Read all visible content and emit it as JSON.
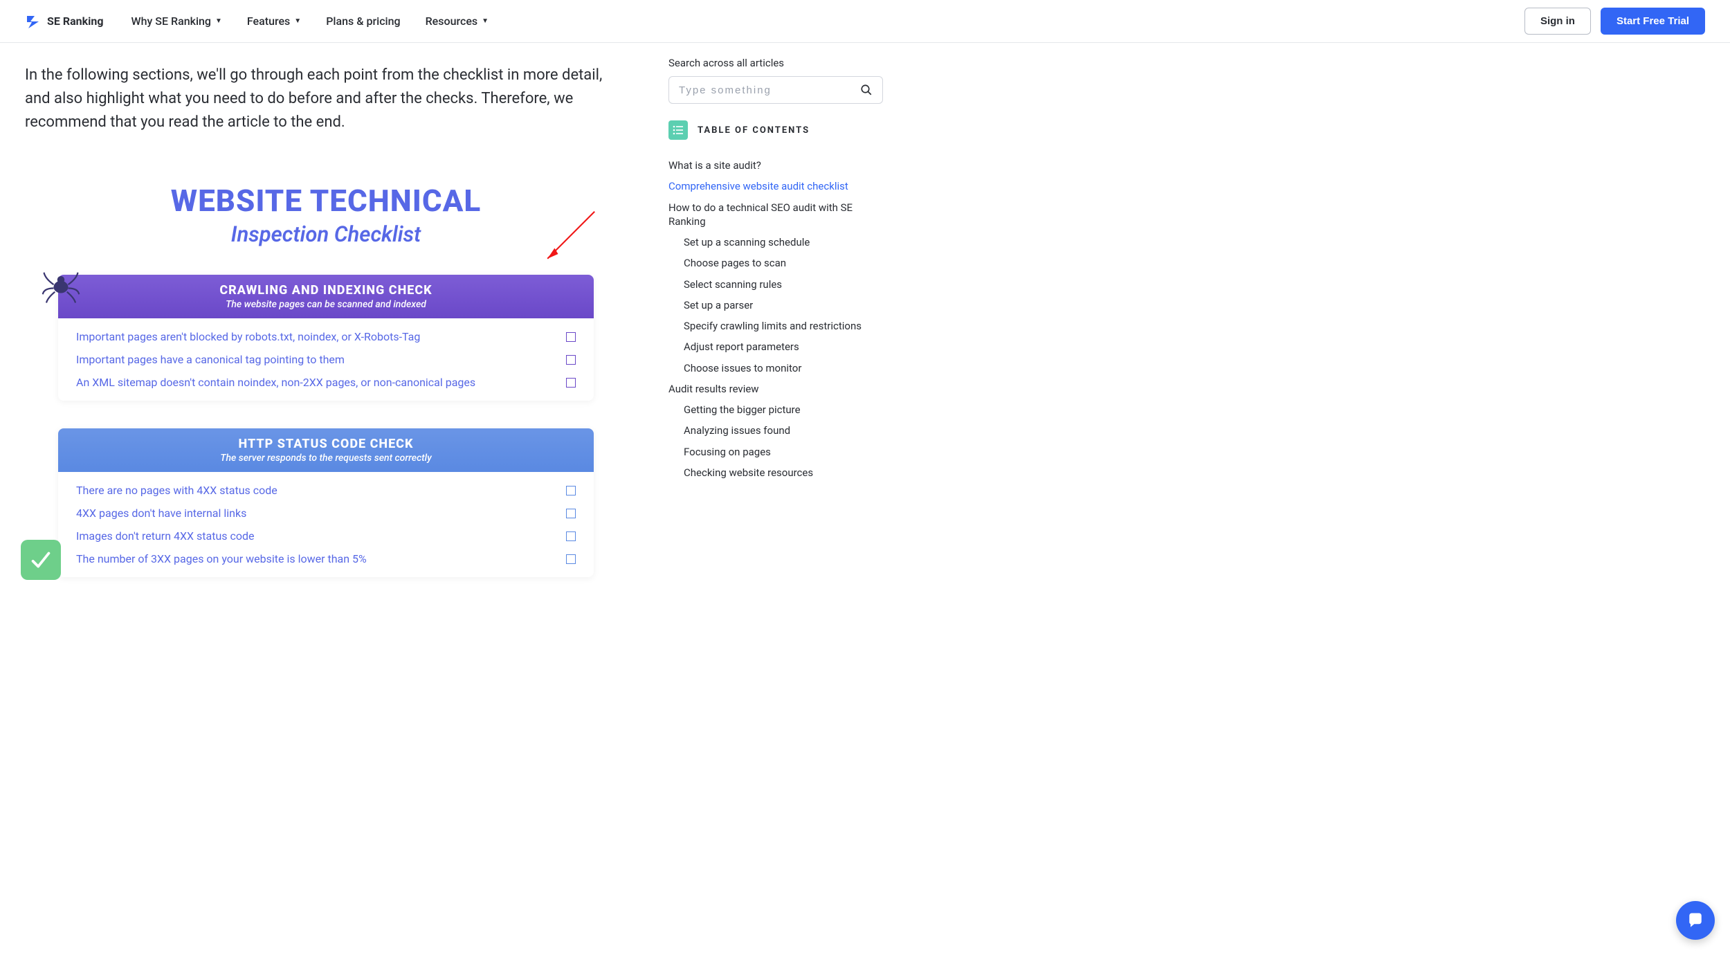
{
  "header": {
    "logo_text": "SE Ranking",
    "nav": [
      {
        "label": "Why SE Ranking",
        "has_sub": true
      },
      {
        "label": "Features",
        "has_sub": true
      },
      {
        "label": "Plans & pricing",
        "has_sub": false
      },
      {
        "label": "Resources",
        "has_sub": true
      }
    ],
    "sign_in": "Sign in",
    "cta": "Start Free Trial"
  },
  "intro_paragraph": "In the following sections, we'll go through each point from the checklist in more detail, and also highlight what you need to do before and after the checks. Therefore, we recommend that you read the article to the end.",
  "checklist": {
    "title": "WEBSITE TECHNICAL",
    "subtitle": "Inspection Checklist",
    "sections": [
      {
        "style": "purple",
        "heading": "CRAWLING AND INDEXING CHECK",
        "sub": "The website pages can be scanned and indexed",
        "items": [
          "Important pages aren't blocked by robots.txt, noindex, or X-Robots-Tag",
          "Important pages have a canonical tag pointing to them",
          "An XML sitemap doesn't contain noindex, non-2XX pages, or non-canonical pages"
        ]
      },
      {
        "style": "blue",
        "heading": "HTTP STATUS CODE CHECK",
        "sub": "The server responds to the requests sent correctly",
        "items": [
          "There are no pages with 4XX status code",
          "4XX pages don't have internal links",
          "Images don't return 4XX status code",
          "The number of 3XX pages on your website is lower than 5%"
        ]
      }
    ]
  },
  "sidebar": {
    "search_label": "Search across all articles",
    "search_placeholder": "Type something",
    "toc_heading": "TABLE OF CONTENTS",
    "toc": [
      {
        "label": "What is a site audit?",
        "level": 0,
        "active": false
      },
      {
        "label": "Comprehensive website audit checklist",
        "level": 0,
        "active": true
      },
      {
        "label": "How to do a technical SEO audit with SE Ranking",
        "level": 0,
        "active": false
      },
      {
        "label": "Set up a scanning schedule",
        "level": 1,
        "active": false
      },
      {
        "label": "Choose pages to scan",
        "level": 1,
        "active": false
      },
      {
        "label": "Select scanning rules",
        "level": 1,
        "active": false
      },
      {
        "label": "Set up a parser",
        "level": 1,
        "active": false
      },
      {
        "label": "Specify crawling limits and restrictions",
        "level": 1,
        "active": false
      },
      {
        "label": "Adjust report parameters",
        "level": 1,
        "active": false
      },
      {
        "label": "Choose issues to monitor",
        "level": 1,
        "active": false
      },
      {
        "label": "Audit results review",
        "level": 0,
        "active": false
      },
      {
        "label": "Getting the bigger picture",
        "level": 1,
        "active": false
      },
      {
        "label": "Analyzing issues found",
        "level": 1,
        "active": false
      },
      {
        "label": "Focusing on pages",
        "level": 1,
        "active": false
      },
      {
        "label": "Checking website resources",
        "level": 1,
        "active": false
      }
    ]
  }
}
